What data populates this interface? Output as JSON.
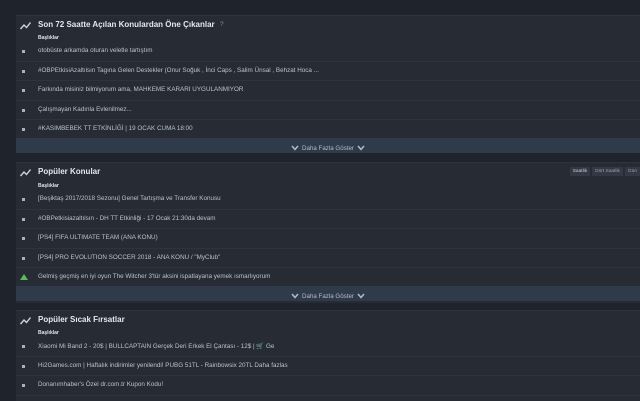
{
  "panels": [
    {
      "title": "Son 72 Saatte Açılan Konulardan Öne Çıkanlar",
      "help": "?",
      "column_header": "Başlıklar",
      "items": [
        "otobüste arkamda oturan veletle tartıştım",
        "#OBPEtkisiAzaltılsın Tagına Gelen Destekler (Onur Soğuk , İnci Caps , Salim Ünsal , Behzat Hoca ...",
        "Farkında misiniz bilmiyorum ama, MAHKEME KARARI UYGULANMIYOR",
        "Çalışmayan Kadınla Evlenilmez...",
        "#KASIMBEBEK TT ETKİNLİĞİ | 19 OCAK CUMA 18:00"
      ],
      "more_label": "Daha Fazla Göster"
    },
    {
      "title": "Popüler Konular",
      "column_header": "Başlıklar",
      "tabs": [
        "Saatlik",
        "Dört Saatlik",
        "Gün"
      ],
      "items": [
        "[Beşiktaş 2017/2018 Sezonu] Genel Tartışma ve Transfer Konusu",
        "#OBPetkisiazaltılsın - DH TT Etkinliği - 17 Ocak 21:30da devam",
        "[PS4] FIFA ULTIMATE TEAM (ANA KONU)",
        "[PS4] PRO EVOLUTION SOCCER 2018 - ANA KONU / \"MyClub\"",
        "Gelmiş geçmiş en iyi oyun The Witcher 3'tür aksini ispatlayana yemek ısmarlıyorum"
      ],
      "more_label": "Daha Fazla Göster"
    },
    {
      "title": "Popüler Sıcak Fırsatlar",
      "column_header": "Başlıklar",
      "items": [
        "Xiaomi Mi Band 2 - 20$ | BULLCAPTAIN Gerçek Deri Erkek El Çantası - 12$ | 🛒 Ge",
        "Hi2Games.com | Haftalık indirimler yenilendi! PUBG 51TL - Rainbowsix 20TL Daha fazlas",
        "Donanımhaber's Özel dr.com.tr Kupon Kodu!"
      ]
    }
  ],
  "colors": {
    "background": "#1f232b",
    "panel": "#262b34",
    "more_bar": "#2f3a4b",
    "accent_green": "#5cb85c",
    "text": "#b9c3cf"
  }
}
